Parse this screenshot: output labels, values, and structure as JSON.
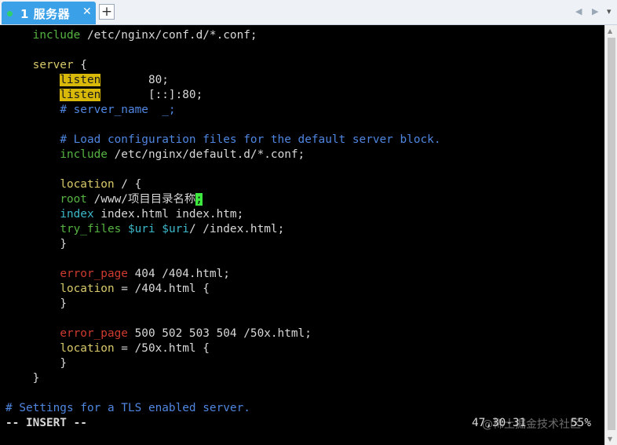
{
  "tab": {
    "title": "1 服务器",
    "close": "✕",
    "new": "+"
  },
  "nav": {
    "prev": "◀",
    "next": "▶",
    "menu": "▾"
  },
  "editor": {
    "include1": {
      "kw": "include",
      "rest": " /etc/nginx/conf.d/*.conf;"
    },
    "server_open": {
      "kw": "server",
      "rest": " {"
    },
    "listen1": {
      "kw": "listen",
      "rest": "       80;"
    },
    "listen2": {
      "kw": "listen",
      "rest": "       [::]:80;"
    },
    "server_name_comment": "# server_name  _;",
    "load_comment": "# Load configuration files for the default server block.",
    "include2": {
      "kw": "include",
      "rest": " /etc/nginx/default.d/*.conf;"
    },
    "location_root": {
      "kw": "location",
      "rest": " / {"
    },
    "root": {
      "kw": "root",
      "rest": " /www/项目目录名称",
      "cursor": ";"
    },
    "index": {
      "kw": "index",
      "rest": " index.html index.htm;"
    },
    "try_files": {
      "kw": "try_files",
      "var1": "$uri",
      "var2": "$uri",
      "rest": "/ /index.html;"
    },
    "close1": "}",
    "error404": {
      "kw": "error_page",
      "rest": " 404 /404.html;"
    },
    "location404": {
      "kw": "location",
      "rest": " = /404.html {"
    },
    "close2": "}",
    "error50x": {
      "kw": "error_page",
      "rest": " 500 502 503 504 /50x.html;"
    },
    "location50x": {
      "kw": "location",
      "rest": " = /50x.html {"
    },
    "close3": "}",
    "server_close": "}",
    "tls_comment": "# Settings for a TLS enabled server."
  },
  "status": {
    "mode": "-- INSERT --",
    "position": "47,30-31",
    "percent": "55%"
  },
  "watermark": "@稀土掘金技术社区",
  "colors": {
    "keyword_yellow": "#d8c96a",
    "comment_blue": "#4f86e0",
    "directive_cyan": "#3bb8c9",
    "keyword_green": "#55b342",
    "error_red": "#cf3b2f",
    "tab_blue": "#3aa0e8"
  }
}
